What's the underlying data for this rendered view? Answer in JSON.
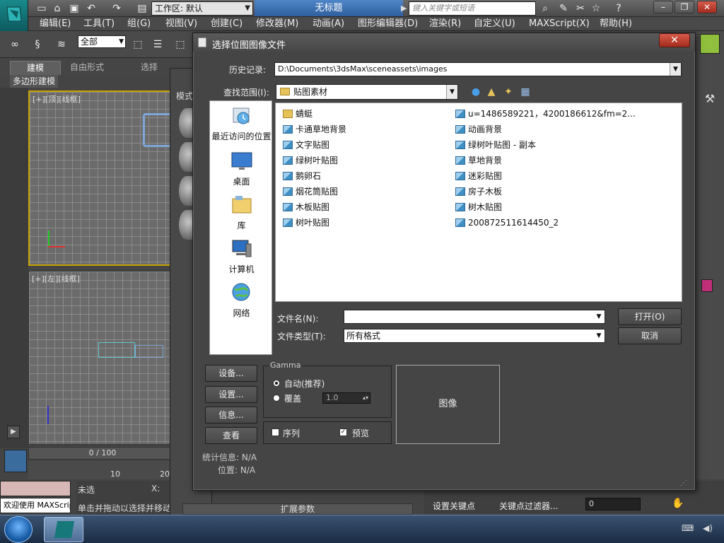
{
  "app": {
    "workspace_label": "工作区: 默认",
    "doc_title": "无标题",
    "search_placeholder": "键入关键字或短语"
  },
  "menu": [
    "编辑(E)",
    "工具(T)",
    "组(G)",
    "视图(V)",
    "创建(C)",
    "修改器(M)",
    "动画(A)",
    "图形编辑器(D)",
    "渲染(R)",
    "自定义(U)",
    "MAXScript(X)",
    "帮助(H)"
  ],
  "toolbar": {
    "selection_filter": "全部"
  },
  "ribbon": {
    "tabs": [
      "建模",
      "自由形式",
      "选择"
    ],
    "sub_tab": "多边形建模"
  },
  "viewports": {
    "top_label": "[+][顶][线框]",
    "front_label": "[+][左][线框]"
  },
  "timeline": {
    "frame_text": "0 / 100",
    "ruler_ticks": [
      "10",
      "20"
    ]
  },
  "status": {
    "welcome": "欢迎使用 MAXScript",
    "prompt": "单击并拖动以选择并移动",
    "selection_lock": "未选",
    "x_label": "X:"
  },
  "bottom_right": {
    "set_key": "设置关键点",
    "key_filter": "关键点过滤器...",
    "frame_value": "0"
  },
  "material_editor": {
    "expand_params": "扩展参数",
    "tab_label": "模式"
  },
  "dialog": {
    "title": "选择位图图像文件",
    "history_label": "历史记录:",
    "history_value": "D:\\Documents\\3dsMax\\sceneassets\\images",
    "lookin_label": "查找范围(I):",
    "lookin_value": "贴图素材",
    "places": [
      "最近访问的位置",
      "桌面",
      "库",
      "计算机",
      "网络"
    ],
    "files_left": [
      {
        "name": "蜻蜓",
        "type": "folder"
      },
      {
        "name": "卡通草地背景",
        "type": "image"
      },
      {
        "name": "文字贴图",
        "type": "image"
      },
      {
        "name": "绿树叶贴图",
        "type": "image"
      },
      {
        "name": "鹅卵石",
        "type": "image"
      },
      {
        "name": "烟花筒贴图",
        "type": "image"
      },
      {
        "name": "木板贴图",
        "type": "image"
      },
      {
        "name": "树叶贴图",
        "type": "image"
      }
    ],
    "files_right": [
      {
        "name": "u=1486589221，4200186612&fm=2...",
        "type": "image"
      },
      {
        "name": "动画背景",
        "type": "image"
      },
      {
        "name": "绿树叶贴图 - 副本",
        "type": "image"
      },
      {
        "name": "草地背景",
        "type": "image"
      },
      {
        "name": "迷彩贴图",
        "type": "image"
      },
      {
        "name": "房子木板",
        "type": "image"
      },
      {
        "name": "树木贴图",
        "type": "image"
      },
      {
        "name": "200872511614450_2",
        "type": "image"
      }
    ],
    "filename_label": "文件名(N):",
    "filename_value": "",
    "filetype_label": "文件类型(T):",
    "filetype_value": "所有格式",
    "open_button": "打开(O)",
    "cancel_button": "取消",
    "devices_button": "设备...",
    "setup_button": "设置...",
    "info_button": "信息...",
    "view_button": "查看",
    "gamma_title": "Gamma",
    "gamma_auto": "自动(推荐)",
    "gamma_override": "覆盖",
    "gamma_value": "1.0",
    "sequence_label": "序列",
    "preview_label": "预览",
    "preview_box": "图像",
    "stats_label": "统计信息: N/A",
    "location_label": "位置: N/A"
  }
}
